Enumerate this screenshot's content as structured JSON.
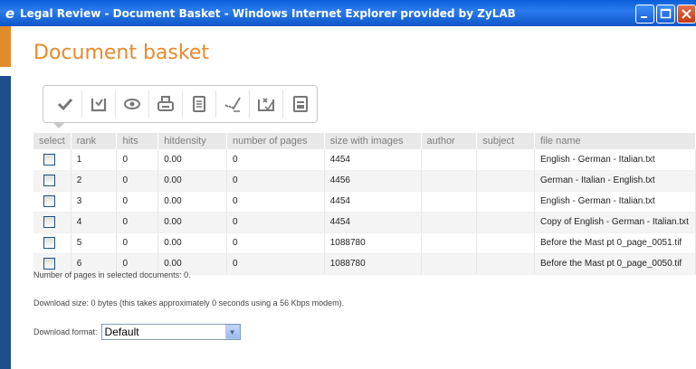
{
  "window": {
    "title": "Legal Review - Document Basket - Windows Internet Explorer provided by ZyLAB"
  },
  "page": {
    "heading": "Document basket"
  },
  "toolbar": {
    "buttons": [
      {
        "icon": "checkmark-icon"
      },
      {
        "icon": "basket-icon"
      },
      {
        "icon": "view-icon"
      },
      {
        "icon": "print-icon"
      },
      {
        "icon": "document-list-icon"
      },
      {
        "icon": "select-all-icon"
      },
      {
        "icon": "clear-basket-icon"
      },
      {
        "icon": "save-icon"
      }
    ]
  },
  "table": {
    "headers": [
      "select",
      "rank",
      "hits",
      "hitdensity",
      "number of pages",
      "size with images",
      "author",
      "subject",
      "file name"
    ],
    "rows": [
      {
        "rank": "1",
        "hits": "0",
        "hitdensity": "0.00",
        "pages": "0",
        "size": "4454",
        "author": "",
        "subject": "",
        "file": "English - German - Italian.txt"
      },
      {
        "rank": "2",
        "hits": "0",
        "hitdensity": "0.00",
        "pages": "0",
        "size": "4456",
        "author": "",
        "subject": "",
        "file": "German - Italian - English.txt"
      },
      {
        "rank": "3",
        "hits": "0",
        "hitdensity": "0.00",
        "pages": "0",
        "size": "4454",
        "author": "",
        "subject": "",
        "file": "English - German - Italian.txt"
      },
      {
        "rank": "4",
        "hits": "0",
        "hitdensity": "0.00",
        "pages": "0",
        "size": "4454",
        "author": "",
        "subject": "",
        "file": "Copy of English - German - Italian.txt"
      },
      {
        "rank": "5",
        "hits": "0",
        "hitdensity": "0.00",
        "pages": "0",
        "size": "1088780",
        "author": "",
        "subject": "",
        "file": "Before the Mast pt 0_page_0051.tif"
      },
      {
        "rank": "6",
        "hits": "0",
        "hitdensity": "0.00",
        "pages": "0",
        "size": "1088780",
        "author": "",
        "subject": "",
        "file": "Before the Mast pt 0_page_0050.tif"
      }
    ]
  },
  "info": {
    "pages_text": "Number of pages in selected documents: 0.",
    "download_text": "Download size: 0 bytes (this takes approximately 0 seconds using a 56 Kbps modem).",
    "format_label": "Download format:",
    "format_value": "Default"
  },
  "colors": {
    "heading": "#e58a2c",
    "accent_orange": "#e28b2b",
    "accent_blue": "#1d4d8c"
  }
}
